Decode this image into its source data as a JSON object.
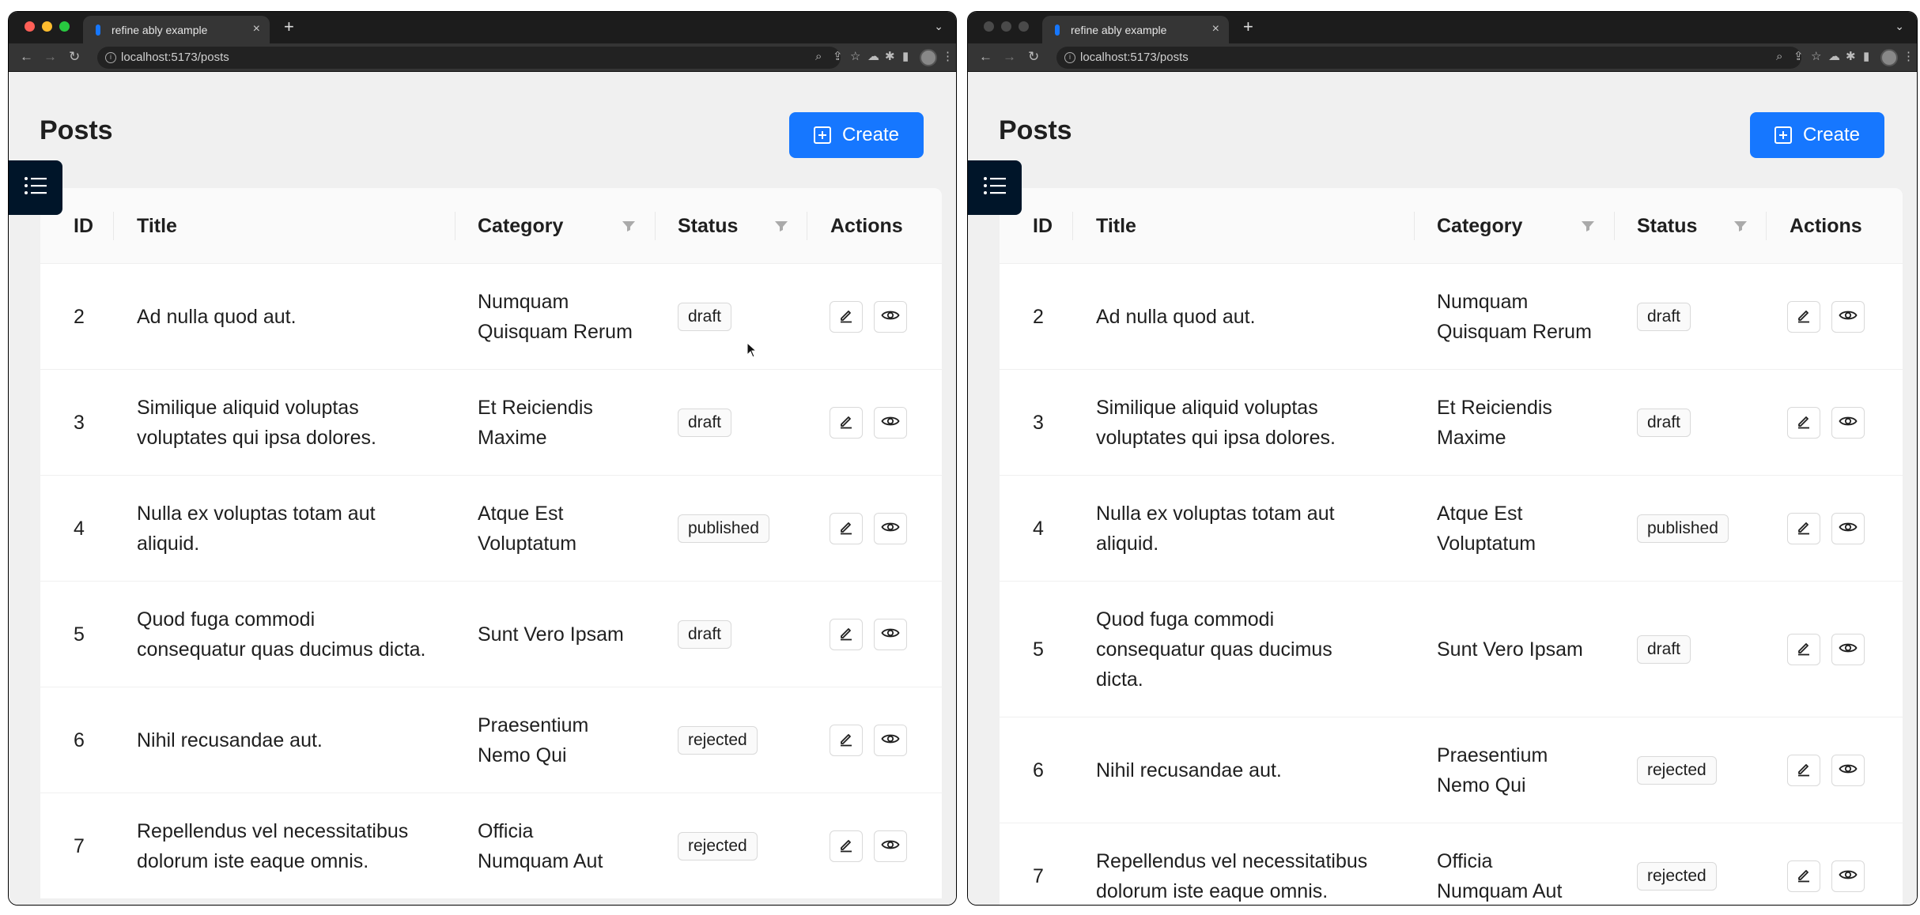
{
  "browser": {
    "tab_title": "refine ably example",
    "url": "localhost:5173/posts",
    "new_tab": "+",
    "close_tab": "×"
  },
  "page": {
    "title": "Posts",
    "create_label": "Create"
  },
  "table": {
    "columns": [
      "ID",
      "Title",
      "Category",
      "Status",
      "Actions"
    ],
    "rows": [
      {
        "id": "2",
        "title": [
          "Ad nulla quod aut."
        ],
        "category": [
          "Numquam",
          "Quisquam Rerum"
        ],
        "status": "draft"
      },
      {
        "id": "3",
        "title": [
          "Similique aliquid voluptas",
          "voluptates qui ipsa dolores."
        ],
        "category": [
          "Et Reiciendis",
          "Maxime"
        ],
        "status": "draft"
      },
      {
        "id": "4",
        "title": [
          "Nulla ex voluptas totam aut",
          "aliquid."
        ],
        "category": [
          "Atque Est",
          "Voluptatum"
        ],
        "status": "published"
      },
      {
        "id": "5",
        "title": [
          "Quod fuga commodi",
          "consequatur quas ducimus dicta."
        ],
        "category": [
          "Sunt Vero Ipsam"
        ],
        "status": "draft"
      },
      {
        "id": "6",
        "title": [
          "Nihil recusandae aut."
        ],
        "category": [
          "Praesentium",
          "Nemo Qui"
        ],
        "status": "rejected"
      },
      {
        "id": "7",
        "title": [
          "Repellendus vel necessitatibus",
          "dolorum iste eaque omnis."
        ],
        "category": [
          "Officia",
          "Numquam Aut"
        ],
        "status": "rejected"
      }
    ],
    "rows_right": [
      {
        "title": [
          "Ad nulla quod aut."
        ]
      },
      {
        "title": [
          "Similique aliquid voluptas",
          "voluptates qui ipsa dolores."
        ]
      },
      {
        "title": [
          "Nulla ex voluptas totam aut",
          "aliquid."
        ]
      },
      {
        "title": [
          "Quod fuga commodi",
          "consequatur quas ducimus",
          "dicta."
        ]
      },
      {
        "title": [
          "Nihil recusandae aut."
        ]
      },
      {
        "title": [
          "Repellendus vel necessitatibus",
          "dolorum iste eaque omnis."
        ]
      }
    ]
  },
  "colors": {
    "primary": "#1677ff",
    "sider": "#001529",
    "traffic_red": "#ff5f57",
    "traffic_yellow": "#febc2e",
    "traffic_green": "#28c840",
    "traffic_inactive": "#4a4a4a"
  },
  "icons": [
    "back-arrow-icon",
    "forward-arrow-icon",
    "reload-icon",
    "info-icon",
    "zoom-icon",
    "share-icon",
    "star-icon",
    "extension-icon",
    "sidebar-icon",
    "menu-list-icon",
    "filter-icon",
    "edit-icon",
    "eye-icon",
    "plus-square-icon",
    "mouse-cursor-icon"
  ]
}
